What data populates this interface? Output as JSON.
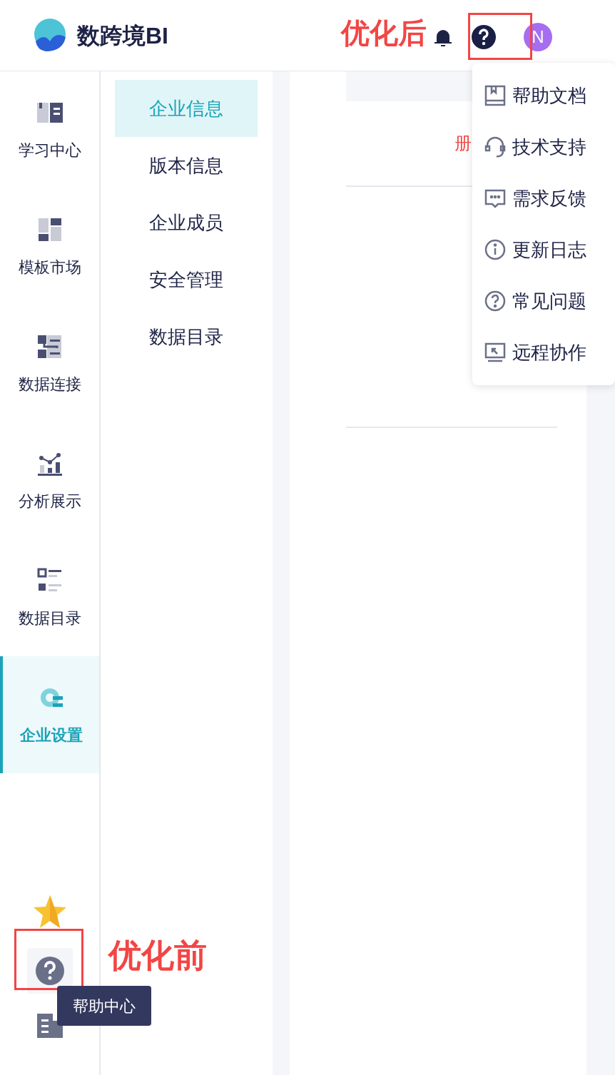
{
  "header": {
    "logo_text": "数跨境BI",
    "avatar": "N"
  },
  "nav": [
    {
      "label": "学习中心",
      "kind": "book",
      "selected": false
    },
    {
      "label": "模板市场",
      "kind": "template",
      "selected": false
    },
    {
      "label": "数据连接",
      "kind": "connect",
      "selected": false
    },
    {
      "label": "分析展示",
      "kind": "chart",
      "selected": false
    },
    {
      "label": "数据目录",
      "kind": "catalog",
      "selected": false
    },
    {
      "label": "企业设置",
      "kind": "settings",
      "selected": true
    }
  ],
  "subnav": [
    {
      "label": "企业信息",
      "selected": true
    },
    {
      "label": "版本信息",
      "selected": false
    },
    {
      "label": "企业成员",
      "selected": false
    },
    {
      "label": "安全管理",
      "selected": false
    },
    {
      "label": "数据目录",
      "selected": false
    }
  ],
  "content": {
    "partial_text": "册"
  },
  "help_menu": [
    {
      "label": "帮助文档",
      "kind": "doc"
    },
    {
      "label": "技术支持",
      "kind": "headset"
    },
    {
      "label": "需求反馈",
      "kind": "feedback"
    },
    {
      "label": "更新日志",
      "kind": "info"
    },
    {
      "label": "常见问题",
      "kind": "question"
    },
    {
      "label": "远程协作",
      "kind": "remote"
    }
  ],
  "tooltip": "帮助中心",
  "annotations": {
    "after": "优化后",
    "before": "优化前"
  }
}
